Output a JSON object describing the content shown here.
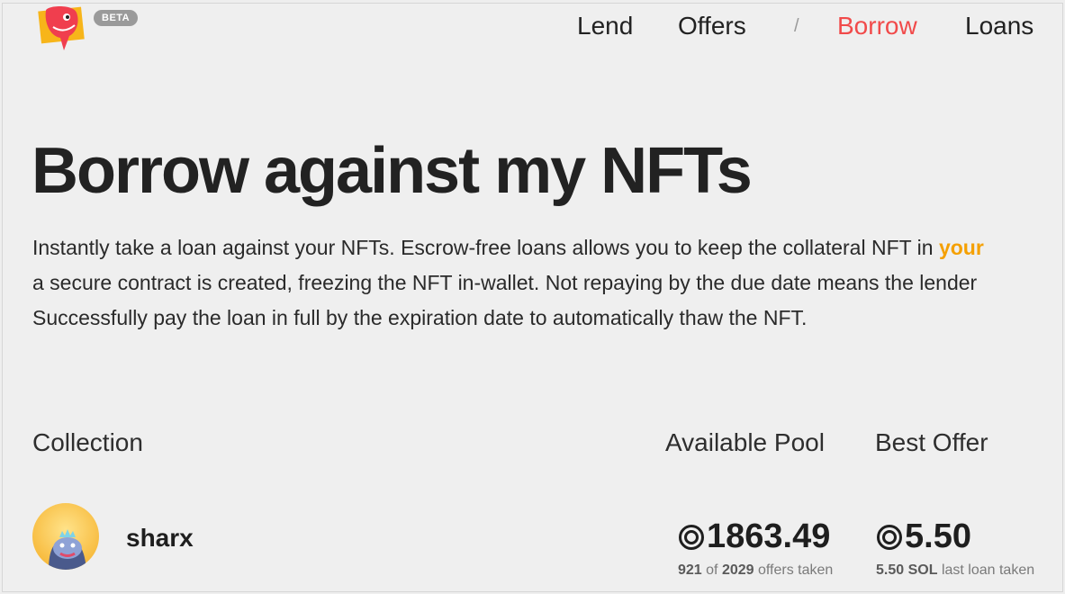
{
  "header": {
    "beta_label": "BETA",
    "nav": {
      "lend": "Lend",
      "offers": "Offers",
      "separator": "/",
      "borrow": "Borrow",
      "loans": "Loans"
    }
  },
  "page": {
    "title": "Borrow against my NFTs",
    "description": {
      "line1_pre": "Instantly take a loan against your NFTs. Escrow-free loans allows you to keep the collateral NFT in ",
      "line1_highlight": "your",
      "line2": "a secure contract is created, freezing the NFT in-wallet. Not repaying by the due date means the lender",
      "line3": "Successfully pay the loan in full by the expiration date to automatically thaw the NFT."
    }
  },
  "table": {
    "headers": {
      "collection": "Collection",
      "available_pool": "Available Pool",
      "best_offer": "Best Offer"
    },
    "rows": [
      {
        "name": "sharx",
        "avatar_icon": "shark-avatar-icon",
        "pool_value": "1863.49",
        "offers_taken": "921",
        "offers_of": "of",
        "offers_total": "2029",
        "offers_suffix": "offers taken",
        "best_offer_value": "5.50",
        "last_loan_amount": "5.50 SOL",
        "last_loan_suffix": "last loan taken"
      }
    ]
  },
  "colors": {
    "accent": "#f14a4a",
    "highlight": "#f5a000",
    "text": "#222222"
  }
}
